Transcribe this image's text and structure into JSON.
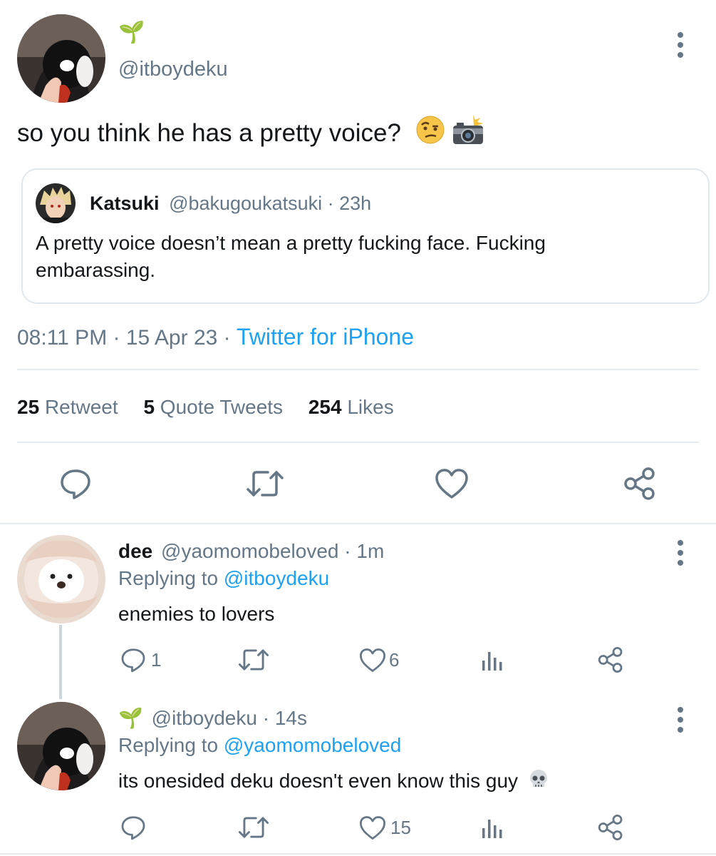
{
  "main_tweet": {
    "display_name": "🌱",
    "handle": "@itboydeku",
    "text": "so you think he has a pretty voice?",
    "emojis": [
      "raised-eyebrow-face",
      "camera-with-flash"
    ],
    "quoted": {
      "name": "Katsuki",
      "handle": "@bakugoukatsuki",
      "sep": "·",
      "time": "23h",
      "text": "A pretty voice doesn’t mean a pretty fucking face. Fucking embarassing."
    },
    "meta": {
      "time": "08:11 PM",
      "sep1": "·",
      "date": "15 Apr 23",
      "sep2": "·",
      "source": "Twitter for iPhone"
    },
    "stats": {
      "retweets_count": "25",
      "retweets_label": "Retweet",
      "quotes_count": "5",
      "quotes_label": "Quote Tweets",
      "likes_count": "254",
      "likes_label": "Likes"
    }
  },
  "replies": [
    {
      "name": "dee",
      "handle": "@yaomomobeloved",
      "sep": "·",
      "time": "1m",
      "replying_prefix": "Replying to",
      "replying_to": "@itboydeku",
      "text": "enemies to lovers",
      "reply_count": "1",
      "like_count": "6"
    },
    {
      "name": "🌱",
      "handle": "@itboydeku",
      "sep": "·",
      "time": "14s",
      "replying_prefix": "Replying to",
      "replying_to": "@yaomomobeloved",
      "text": "its onesided deku doesn't even know this guy",
      "reply_count": "",
      "like_count": "15"
    }
  ],
  "colors": {
    "link": "#1da1f2",
    "muted": "#657786",
    "text": "#14171a",
    "border": "#e6ecf0"
  }
}
